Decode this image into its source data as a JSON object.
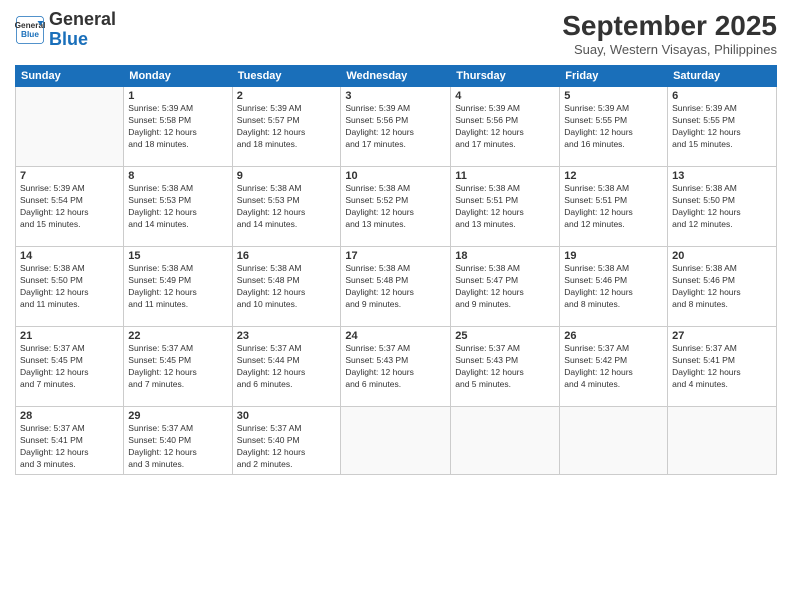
{
  "header": {
    "logo_line1": "General",
    "logo_line2": "Blue",
    "month": "September 2025",
    "location": "Suay, Western Visayas, Philippines"
  },
  "columns": [
    "Sunday",
    "Monday",
    "Tuesday",
    "Wednesday",
    "Thursday",
    "Friday",
    "Saturday"
  ],
  "weeks": [
    [
      {
        "day": "",
        "info": ""
      },
      {
        "day": "1",
        "info": "Sunrise: 5:39 AM\nSunset: 5:58 PM\nDaylight: 12 hours\nand 18 minutes."
      },
      {
        "day": "2",
        "info": "Sunrise: 5:39 AM\nSunset: 5:57 PM\nDaylight: 12 hours\nand 18 minutes."
      },
      {
        "day": "3",
        "info": "Sunrise: 5:39 AM\nSunset: 5:56 PM\nDaylight: 12 hours\nand 17 minutes."
      },
      {
        "day": "4",
        "info": "Sunrise: 5:39 AM\nSunset: 5:56 PM\nDaylight: 12 hours\nand 17 minutes."
      },
      {
        "day": "5",
        "info": "Sunrise: 5:39 AM\nSunset: 5:55 PM\nDaylight: 12 hours\nand 16 minutes."
      },
      {
        "day": "6",
        "info": "Sunrise: 5:39 AM\nSunset: 5:55 PM\nDaylight: 12 hours\nand 15 minutes."
      }
    ],
    [
      {
        "day": "7",
        "info": "Sunrise: 5:39 AM\nSunset: 5:54 PM\nDaylight: 12 hours\nand 15 minutes."
      },
      {
        "day": "8",
        "info": "Sunrise: 5:38 AM\nSunset: 5:53 PM\nDaylight: 12 hours\nand 14 minutes."
      },
      {
        "day": "9",
        "info": "Sunrise: 5:38 AM\nSunset: 5:53 PM\nDaylight: 12 hours\nand 14 minutes."
      },
      {
        "day": "10",
        "info": "Sunrise: 5:38 AM\nSunset: 5:52 PM\nDaylight: 12 hours\nand 13 minutes."
      },
      {
        "day": "11",
        "info": "Sunrise: 5:38 AM\nSunset: 5:51 PM\nDaylight: 12 hours\nand 13 minutes."
      },
      {
        "day": "12",
        "info": "Sunrise: 5:38 AM\nSunset: 5:51 PM\nDaylight: 12 hours\nand 12 minutes."
      },
      {
        "day": "13",
        "info": "Sunrise: 5:38 AM\nSunset: 5:50 PM\nDaylight: 12 hours\nand 12 minutes."
      }
    ],
    [
      {
        "day": "14",
        "info": "Sunrise: 5:38 AM\nSunset: 5:50 PM\nDaylight: 12 hours\nand 11 minutes."
      },
      {
        "day": "15",
        "info": "Sunrise: 5:38 AM\nSunset: 5:49 PM\nDaylight: 12 hours\nand 11 minutes."
      },
      {
        "day": "16",
        "info": "Sunrise: 5:38 AM\nSunset: 5:48 PM\nDaylight: 12 hours\nand 10 minutes."
      },
      {
        "day": "17",
        "info": "Sunrise: 5:38 AM\nSunset: 5:48 PM\nDaylight: 12 hours\nand 9 minutes."
      },
      {
        "day": "18",
        "info": "Sunrise: 5:38 AM\nSunset: 5:47 PM\nDaylight: 12 hours\nand 9 minutes."
      },
      {
        "day": "19",
        "info": "Sunrise: 5:38 AM\nSunset: 5:46 PM\nDaylight: 12 hours\nand 8 minutes."
      },
      {
        "day": "20",
        "info": "Sunrise: 5:38 AM\nSunset: 5:46 PM\nDaylight: 12 hours\nand 8 minutes."
      }
    ],
    [
      {
        "day": "21",
        "info": "Sunrise: 5:37 AM\nSunset: 5:45 PM\nDaylight: 12 hours\nand 7 minutes."
      },
      {
        "day": "22",
        "info": "Sunrise: 5:37 AM\nSunset: 5:45 PM\nDaylight: 12 hours\nand 7 minutes."
      },
      {
        "day": "23",
        "info": "Sunrise: 5:37 AM\nSunset: 5:44 PM\nDaylight: 12 hours\nand 6 minutes."
      },
      {
        "day": "24",
        "info": "Sunrise: 5:37 AM\nSunset: 5:43 PM\nDaylight: 12 hours\nand 6 minutes."
      },
      {
        "day": "25",
        "info": "Sunrise: 5:37 AM\nSunset: 5:43 PM\nDaylight: 12 hours\nand 5 minutes."
      },
      {
        "day": "26",
        "info": "Sunrise: 5:37 AM\nSunset: 5:42 PM\nDaylight: 12 hours\nand 4 minutes."
      },
      {
        "day": "27",
        "info": "Sunrise: 5:37 AM\nSunset: 5:41 PM\nDaylight: 12 hours\nand 4 minutes."
      }
    ],
    [
      {
        "day": "28",
        "info": "Sunrise: 5:37 AM\nSunset: 5:41 PM\nDaylight: 12 hours\nand 3 minutes."
      },
      {
        "day": "29",
        "info": "Sunrise: 5:37 AM\nSunset: 5:40 PM\nDaylight: 12 hours\nand 3 minutes."
      },
      {
        "day": "30",
        "info": "Sunrise: 5:37 AM\nSunset: 5:40 PM\nDaylight: 12 hours\nand 2 minutes."
      },
      {
        "day": "",
        "info": ""
      },
      {
        "day": "",
        "info": ""
      },
      {
        "day": "",
        "info": ""
      },
      {
        "day": "",
        "info": ""
      }
    ]
  ]
}
